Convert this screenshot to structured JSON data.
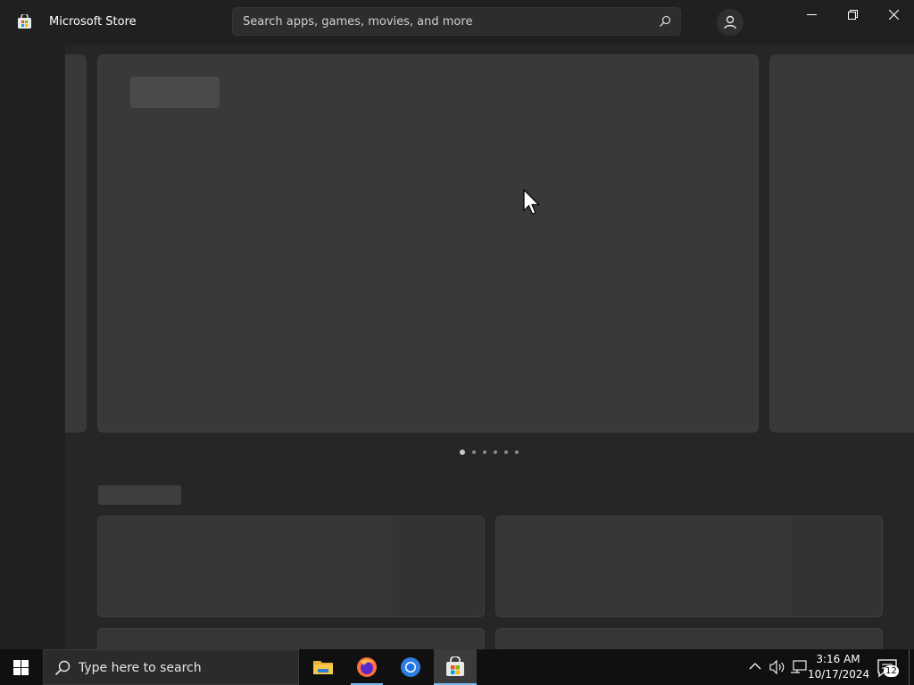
{
  "window": {
    "title": "Microsoft Store",
    "controls": [
      "minimize",
      "restore",
      "close"
    ]
  },
  "search": {
    "placeholder": "Search apps, games, movies, and more"
  },
  "carousel": {
    "dot_count": 6,
    "active_index": 0
  },
  "taskbar": {
    "search_placeholder": "Type here to search",
    "apps": [
      "file-explorer",
      "firefox",
      "chrome",
      "microsoft-store"
    ],
    "active_app": "microsoft-store",
    "time": "3:16 AM",
    "date": "10/17/2024",
    "notification_count": "12"
  },
  "colors": {
    "accent": "#76b9ed",
    "background": "#1c1c1c"
  }
}
